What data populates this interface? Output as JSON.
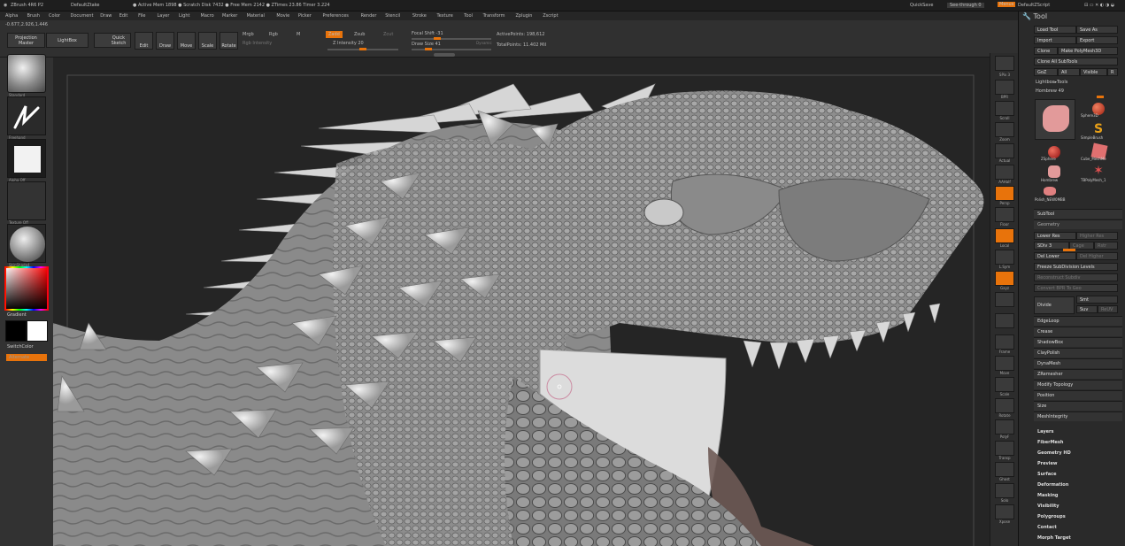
{
  "titlebar": {
    "app": "ZBrush 4R6 P2",
    "doc": "DefaultZtake",
    "stats": "● Active Mem 1898 ● Scratch Disk 7432 ● Free Mem 2142 ● ZTimes 23.86 Timer 3.224",
    "quicksave": "QuickSave",
    "seethrough": "See-through 0",
    "menus": "Menus",
    "script": "DefaultZScript"
  },
  "menubar": [
    "Alpha",
    "Brush",
    "Color",
    "Document",
    "Draw",
    "Edit",
    "File",
    "Layer",
    "Light",
    "Macro",
    "Marker",
    "Material",
    "Movie",
    "Picker",
    "Preferences",
    "Render",
    "Stencil",
    "Stroke",
    "Texture",
    "Tool",
    "Transform",
    "Zplugin",
    "Zscript"
  ],
  "shelf": {
    "coords": "-0.677,2.926,1.446",
    "projection_master": "Projection Master",
    "lightbox": "LightBox",
    "quick_sketch": "Quick Sketch",
    "edit": "Edit",
    "draw": "Draw",
    "move": "Move",
    "scale": "Scale",
    "rotate": "Rotate",
    "mrgb": "Mrgb",
    "rgb": "Rgb",
    "m": "M",
    "rgb_intensity": "Rgb Intensity",
    "zadd": "Zadd",
    "zsub": "Zsub",
    "zcut": "Zcut",
    "z_intensity": "Z Intensity 20",
    "focal_shift": "Focal Shift -31",
    "draw_size": "Draw Size 41",
    "dynamic": "Dynamic",
    "active_points": "ActivePoints: 198,612",
    "total_points": "TotalPoints: 11.402 Mil"
  },
  "lefttray": {
    "brush_label": "Standard",
    "stroke_label": "Freehand",
    "alpha_label": "Alpha Off",
    "texture_label": "Texture Off",
    "material_label": "SkinShade4",
    "gradient": "Gradient",
    "switchcolor": "SwitchColor",
    "alternate": "Alternate"
  },
  "righttray": {
    "spix": "SPix 3",
    "buttons": [
      "BPR",
      "Scroll",
      "Zoom",
      "Actual",
      "AAHalf",
      "Persp",
      "Floor",
      "Local",
      "L.Sym",
      "Gxyz",
      "",
      "",
      "Frame",
      "Move",
      "Scale",
      "Rotate",
      "PolyF",
      "Transp",
      "Ghost",
      "Solo",
      "Xpose"
    ]
  },
  "tool": {
    "title": "Tool",
    "load_tool": "Load Tool",
    "save_as": "Save As",
    "import": "Import",
    "export": "Export",
    "clone": "Clone",
    "make_polymesh": "Make PolyMesh3D",
    "clone_all": "Clone All SubTools",
    "goz": "GoZ",
    "all": "All",
    "visible": "Visible",
    "r": "R",
    "lightbox_tools": "Lightbox▸Tools",
    "hombrew": "Hombrew 49",
    "thumbs": [
      "Hombrew",
      "Sphere3D",
      "ZSphere",
      "Cube_MeshMe",
      "Hombrew",
      "TBPolyMesh_1",
      "Polish_NEW0MBB"
    ],
    "simplebrush": "SimpleBrush",
    "subtool": "SubTool",
    "geometry": "Geometry",
    "lower_res": "Lower Res",
    "higher_res": "Higher Res",
    "sdiv": "SDiv 3",
    "cage": "Cage",
    "rstr": "Rstr",
    "del_lower": "Del Lower",
    "del_higher": "Del Higher",
    "freeze": "Freeze SubDivision Levels",
    "reconstruct": "Reconstruct Subdiv",
    "convert_bpr": "Convert BPR To Geo",
    "divide": "Divide",
    "smt": "Smt",
    "suv": "Suv",
    "reuv": "ReUV",
    "geo_items": [
      "EdgeLoop",
      "Crease",
      "ShadowBox",
      "ClayPolish",
      "DynaMesh",
      "ZRemesher",
      "Modify Topology",
      "Position",
      "Size",
      "MeshIntegrity"
    ],
    "sections": [
      "Layers",
      "FiberMesh",
      "Geometry HD",
      "Preview",
      "Surface",
      "Deformation",
      "Masking",
      "Visibility",
      "Polygroups",
      "Contact",
      "Morph Target"
    ]
  },
  "colors": {
    "accent": "#e8730b",
    "panel": "#2a2a2a",
    "canvas": "#252525"
  }
}
